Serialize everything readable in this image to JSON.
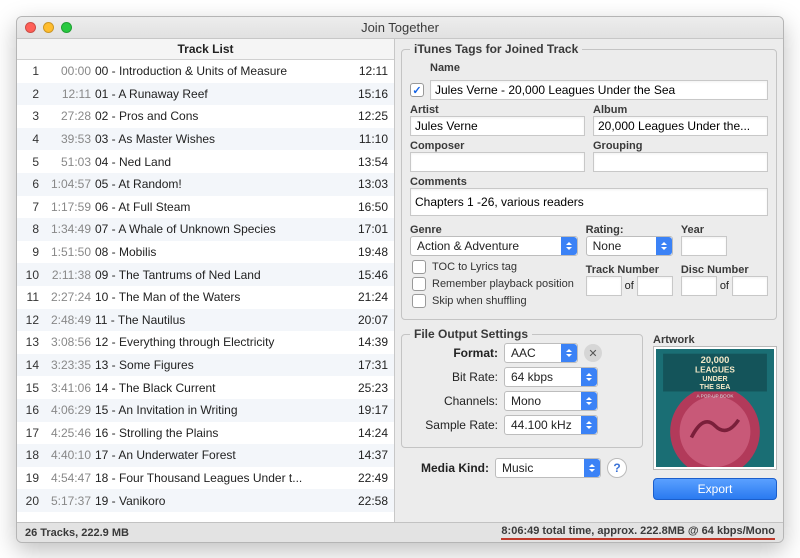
{
  "window": {
    "title": "Join Together"
  },
  "trackList": {
    "header": "Track List",
    "rows": [
      {
        "n": "1",
        "start": "00:00",
        "name": "00 - Introduction & Units of Measure",
        "dur": "12:11"
      },
      {
        "n": "2",
        "start": "12:11",
        "name": "01 - A Runaway Reef",
        "dur": "15:16"
      },
      {
        "n": "3",
        "start": "27:28",
        "name": "02 - Pros and Cons",
        "dur": "12:25"
      },
      {
        "n": "4",
        "start": "39:53",
        "name": "03 - As Master Wishes",
        "dur": "11:10"
      },
      {
        "n": "5",
        "start": "51:03",
        "name": "04 - Ned Land",
        "dur": "13:54"
      },
      {
        "n": "6",
        "start": "1:04:57",
        "name": "05 - At Random!",
        "dur": "13:03"
      },
      {
        "n": "7",
        "start": "1:17:59",
        "name": "06 - At Full Steam",
        "dur": "16:50"
      },
      {
        "n": "8",
        "start": "1:34:49",
        "name": "07 - A Whale of Unknown Species",
        "dur": "17:01"
      },
      {
        "n": "9",
        "start": "1:51:50",
        "name": "08 - Mobilis",
        "dur": "19:48"
      },
      {
        "n": "10",
        "start": "2:11:38",
        "name": "09 - The Tantrums of Ned Land",
        "dur": "15:46"
      },
      {
        "n": "11",
        "start": "2:27:24",
        "name": "10 - The Man of the Waters",
        "dur": "21:24"
      },
      {
        "n": "12",
        "start": "2:48:49",
        "name": "11 - The Nautilus",
        "dur": "20:07"
      },
      {
        "n": "13",
        "start": "3:08:56",
        "name": "12 - Everything through Electricity",
        "dur": "14:39"
      },
      {
        "n": "14",
        "start": "3:23:35",
        "name": "13 - Some Figures",
        "dur": "17:31"
      },
      {
        "n": "15",
        "start": "3:41:06",
        "name": "14 - The Black Current",
        "dur": "25:23"
      },
      {
        "n": "16",
        "start": "4:06:29",
        "name": "15 - An Invitation in Writing",
        "dur": "19:17"
      },
      {
        "n": "17",
        "start": "4:25:46",
        "name": "16 - Strolling the Plains",
        "dur": "14:24"
      },
      {
        "n": "18",
        "start": "4:40:10",
        "name": "17 - An Underwater Forest",
        "dur": "14:37"
      },
      {
        "n": "19",
        "start": "4:54:47",
        "name": "18 - Four Thousand Leagues Under t...",
        "dur": "22:49"
      },
      {
        "n": "20",
        "start": "5:17:37",
        "name": "19 - Vanikoro",
        "dur": "22:58"
      }
    ]
  },
  "tags": {
    "boxTitle": "iTunes Tags for Joined Track",
    "labels": {
      "name": "Name",
      "artist": "Artist",
      "album": "Album",
      "composer": "Composer",
      "grouping": "Grouping",
      "comments": "Comments",
      "genre": "Genre",
      "rating": "Rating:",
      "year": "Year",
      "trackNumber": "Track Number",
      "discNumber": "Disc Number",
      "of": "of",
      "toc": "TOC to Lyrics tag",
      "remember": "Remember playback position",
      "skip": "Skip when shuffling"
    },
    "values": {
      "name": "Jules Verne - 20,000 Leagues Under the Sea",
      "artist": "Jules Verne",
      "album": "20,000 Leagues Under the...",
      "composer": "",
      "grouping": "",
      "comments": "Chapters 1 -26, various readers",
      "genre": "Action & Adventure",
      "rating": "None",
      "year": "",
      "trackNum": "",
      "trackTotal": "",
      "discNum": "",
      "discTotal": ""
    },
    "checks": {
      "name": true,
      "toc": false,
      "remember": false,
      "skip": false
    }
  },
  "output": {
    "boxTitle": "File Output Settings",
    "labels": {
      "format": "Format:",
      "bitrate": "Bit Rate:",
      "channels": "Channels:",
      "samplerate": "Sample Rate:",
      "mediakind": "Media Kind:",
      "artwork": "Artwork",
      "export": "Export",
      "help": "?",
      "clear": "✕"
    },
    "values": {
      "format": "AAC",
      "bitrate": "64 kbps",
      "channels": "Mono",
      "samplerate": "44.100 kHz",
      "mediakind": "Music"
    }
  },
  "artwork": {
    "line1": "20,000",
    "line2": "LEAGUES",
    "line3": "UNDER",
    "line4": "THE SEA",
    "sub": "A POP-UP BOOK"
  },
  "status": {
    "left": "26 Tracks, 222.9 MB",
    "right": "8:06:49 total time, approx. 222.8MB @ 64 kbps/Mono"
  }
}
